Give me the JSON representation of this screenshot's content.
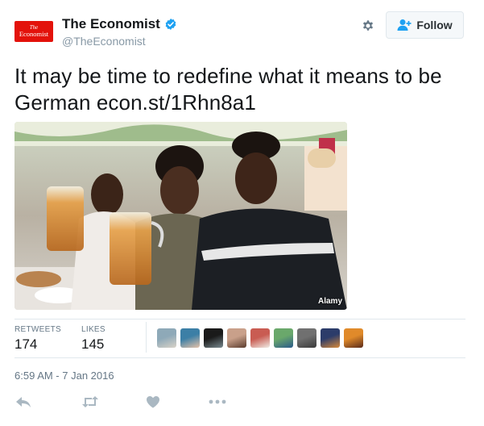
{
  "author": {
    "name": "The Economist",
    "handle": "@TheEconomist",
    "logo_line1": "The",
    "logo_line2": "Economist",
    "brand_color": "#e3120b",
    "verified_color": "#1da1f2"
  },
  "header": {
    "follow_label": "Follow",
    "settings_icon": "gear-icon"
  },
  "tweet": {
    "text": "It may be time to redefine what it means to be German ",
    "link": "econ.st/1Rhn8a1",
    "photo_credit": "Alamy"
  },
  "stats": {
    "retweets_label": "RETWEETS",
    "retweets_value": "174",
    "likes_label": "LIKES",
    "likes_value": "145"
  },
  "likers": [
    {
      "colors": [
        "#8ea9b8",
        "#d9d3c8"
      ]
    },
    {
      "colors": [
        "#3c7fa6",
        "#e6c3aa"
      ]
    },
    {
      "colors": [
        "#1a1a1a",
        "#7a8a90"
      ]
    },
    {
      "colors": [
        "#c9a08a",
        "#5a3b2c"
      ]
    },
    {
      "colors": [
        "#c95c52",
        "#f0ece6"
      ]
    },
    {
      "colors": [
        "#6aa86b",
        "#2a5a8a"
      ]
    },
    {
      "colors": [
        "#707070",
        "#3a3a3a"
      ]
    },
    {
      "colors": [
        "#2c3c6a",
        "#d88a3a"
      ]
    },
    {
      "colors": [
        "#e08a2a",
        "#5a2a1a"
      ]
    }
  ],
  "timestamp": "6:59 AM - 7 Jan 2016",
  "actions": [
    "reply-icon",
    "retweet-icon",
    "like-icon",
    "more-icon"
  ]
}
